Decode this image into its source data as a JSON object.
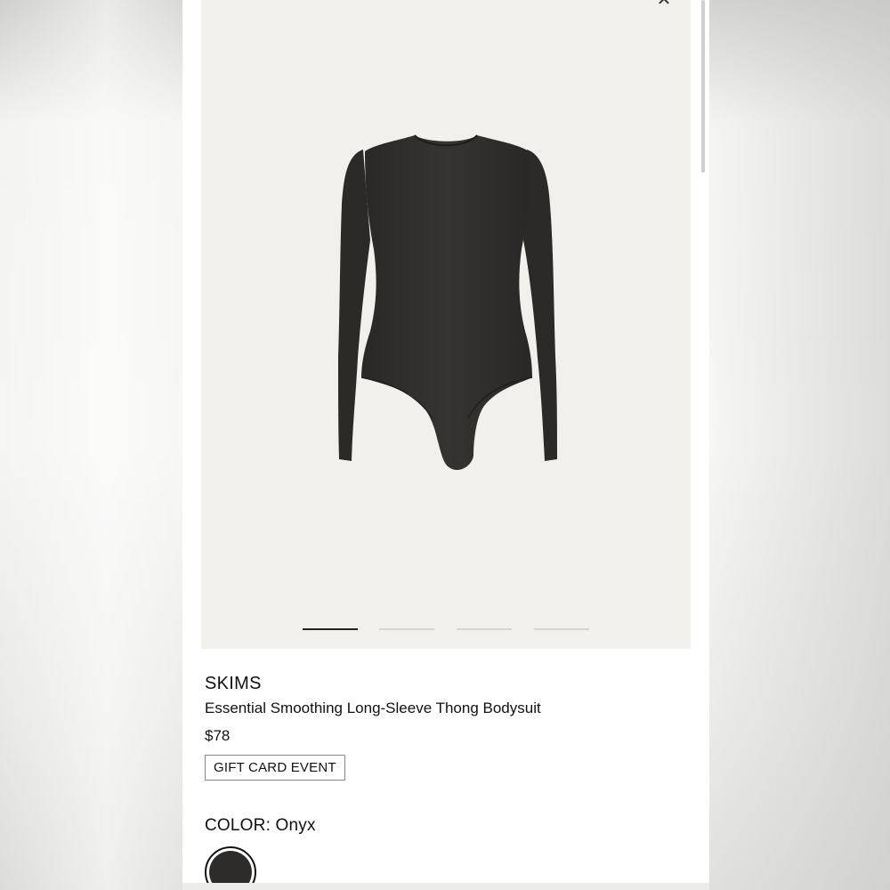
{
  "product": {
    "brand": "SKIMS",
    "name": "Essential Smoothing Long-Sleeve Thong Bodysuit",
    "price": "$78",
    "promo_badge": "GIFT CARD EVENT"
  },
  "carousel": {
    "slide_count": 4,
    "active_slide": 1,
    "close_icon": "close-icon",
    "image_alt": "Essential Smoothing Long-Sleeve Thong Bodysuit in Onyx"
  },
  "color": {
    "label": "COLOR:",
    "selected": "Onyx",
    "swatch_hex": "#2d2c2b"
  },
  "colors": {
    "image_background": "#f1f0ec",
    "garment": "#2f2d2b",
    "text": "#111111"
  }
}
